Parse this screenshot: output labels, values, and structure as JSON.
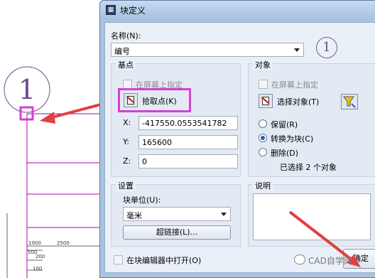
{
  "dialog": {
    "title": "块定义",
    "title_icon": "block-icon",
    "name_label": "名称(N):",
    "name_value": "编号",
    "circled_marker": "1"
  },
  "base_point": {
    "group_title": "基点",
    "specify_on_screen": "在屏幕上指定",
    "pick_point_label": "拾取点(K)",
    "x_label": "X:",
    "x_value": "-417550.0553541782",
    "y_label": "Y:",
    "y_value": "165600",
    "z_label": "Z:",
    "z_value": "0"
  },
  "objects": {
    "group_title": "对象",
    "specify_on_screen": "在屏幕上指定",
    "select_objects_label": "选择对象(T)",
    "retain_label": "保留(R)",
    "convert_label": "转换为块(C)",
    "delete_label": "删除(D)",
    "selected_status": "已选择 2 个对象",
    "selected_option": "convert"
  },
  "settings": {
    "group_title": "设置",
    "unit_label": "块单位(U):",
    "unit_value": "毫米",
    "hyperlink_label": "超链接(L)..."
  },
  "description": {
    "group_title": "说明"
  },
  "footer": {
    "open_in_editor_label": "在块编辑器中打开(O)",
    "ok_label": "确定"
  },
  "drawing": {
    "circled_marker": "1",
    "dims": [
      "1000",
      "2500",
      "500",
      "200",
      "100"
    ]
  },
  "watermark": {
    "text": "CAD自学网"
  },
  "colors": {
    "highlight": "#d63fd6",
    "arrow": "#e04040",
    "cad_line": "#b000b0"
  }
}
